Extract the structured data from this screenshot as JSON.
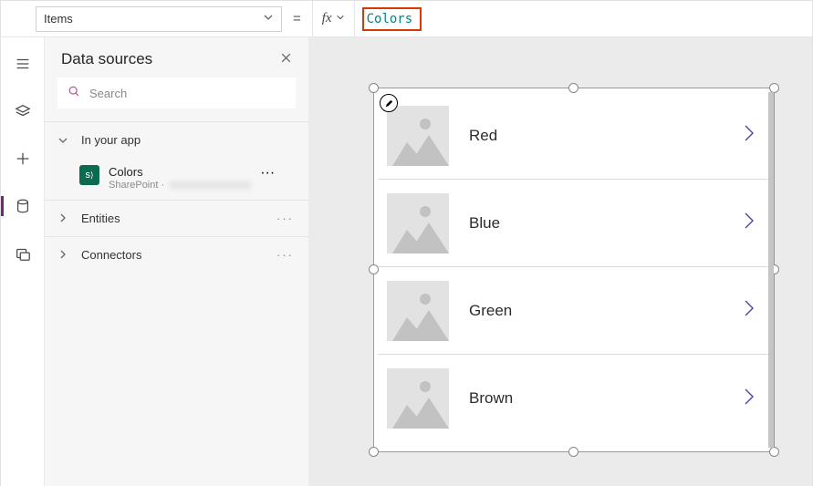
{
  "formula_bar": {
    "property": "Items",
    "formula": "Colors"
  },
  "panel": {
    "title": "Data sources",
    "search_placeholder": "Search",
    "sections": {
      "in_app": "In your app",
      "entities": "Entities",
      "connectors": "Connectors"
    },
    "data_source": {
      "name": "Colors",
      "connector": "SharePoint"
    }
  },
  "gallery": {
    "items": [
      {
        "title": "Red"
      },
      {
        "title": "Blue"
      },
      {
        "title": "Green"
      },
      {
        "title": "Brown"
      }
    ]
  },
  "icons": {
    "chevron_down": "⌄",
    "equals": "=",
    "fx": "fx",
    "more": "···"
  }
}
